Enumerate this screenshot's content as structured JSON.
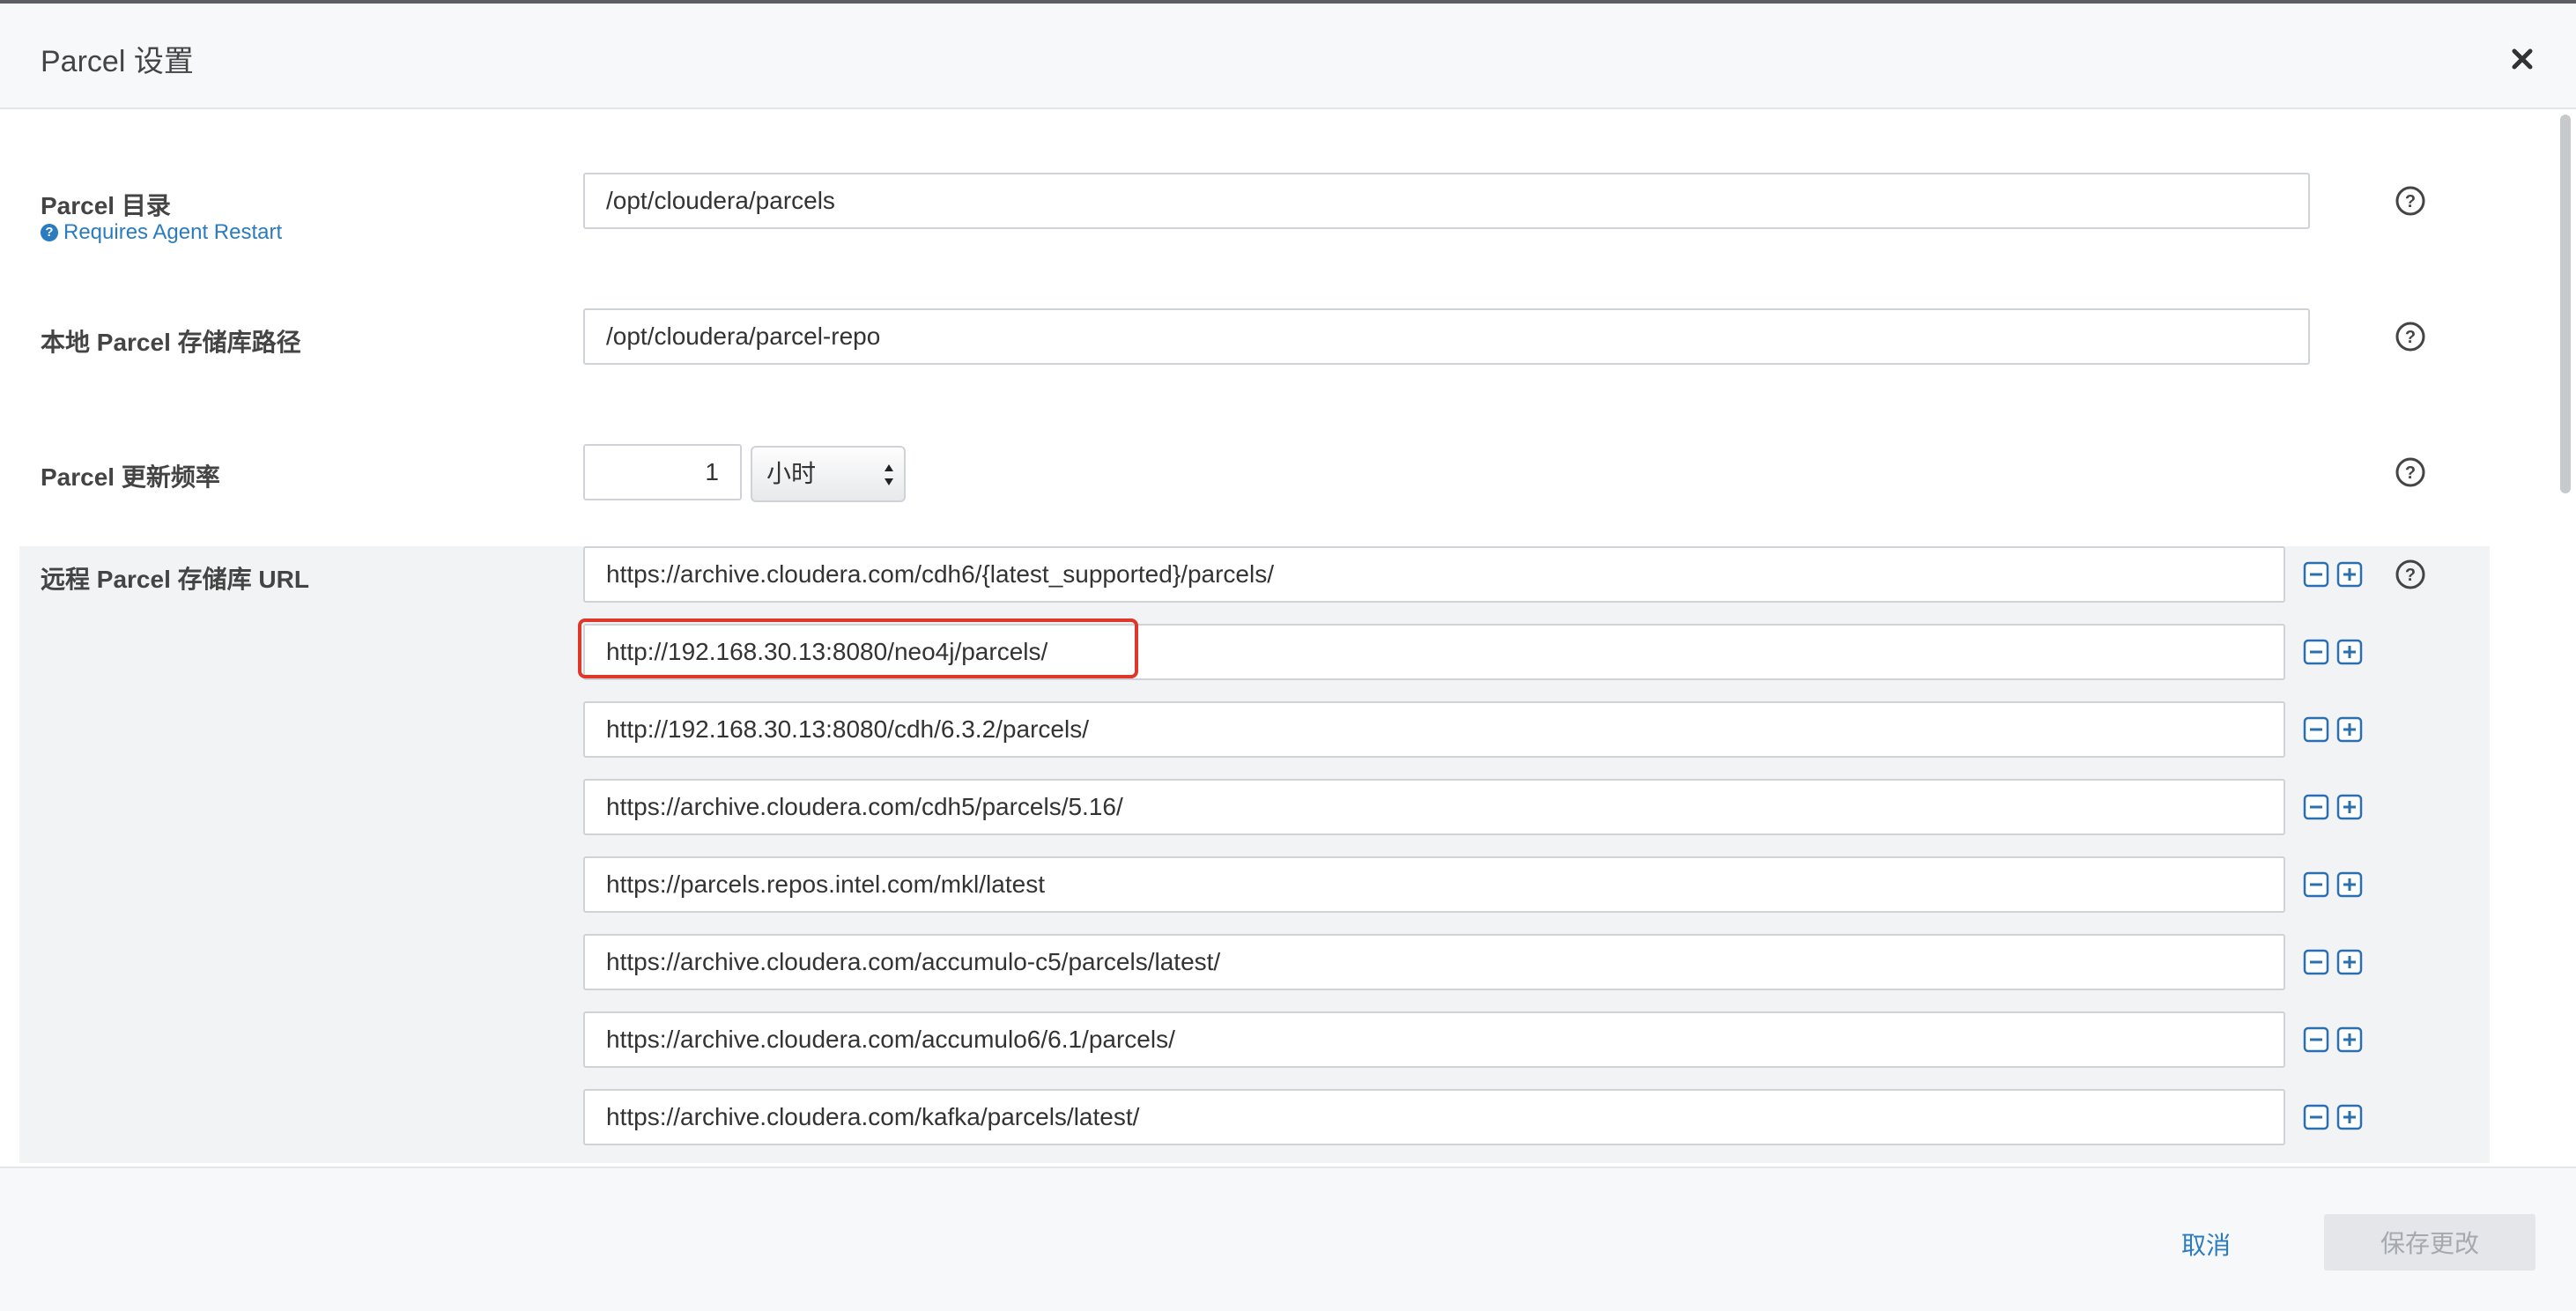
{
  "dialog": {
    "title": "Parcel 设置",
    "close_icon": "close-icon"
  },
  "settings": {
    "parcel_dir": {
      "label": "Parcel 目录",
      "note": "Requires Agent Restart",
      "value": "/opt/cloudera/parcels"
    },
    "local_repo": {
      "label": "本地 Parcel 存储库路径",
      "value": "/opt/cloudera/parcel-repo"
    },
    "update_freq": {
      "label": "Parcel 更新频率",
      "value": "1",
      "unit": "小时"
    },
    "remote_urls": {
      "label": "远程 Parcel 存储库 URL",
      "items": [
        "https://archive.cloudera.com/cdh6/{latest_supported}/parcels/",
        "http://192.168.30.13:8080/neo4j/parcels/",
        "http://192.168.30.13:8080/cdh/6.3.2/parcels/",
        "https://archive.cloudera.com/cdh5/parcels/5.16/",
        "https://parcels.repos.intel.com/mkl/latest",
        "https://archive.cloudera.com/accumulo-c5/parcels/latest/",
        "https://archive.cloudera.com/accumulo6/6.1/parcels/",
        "https://archive.cloudera.com/kafka/parcels/latest/"
      ]
    }
  },
  "footer": {
    "cancel_label": "取消",
    "save_label": "保存更改"
  },
  "colors": {
    "accent": "#2a7bbf",
    "highlight": "#e0372b"
  }
}
